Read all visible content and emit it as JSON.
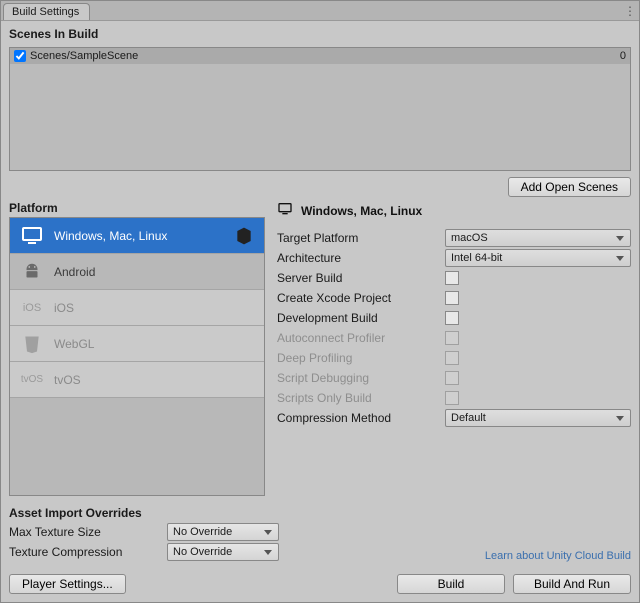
{
  "tab": {
    "title": "Build Settings"
  },
  "scenes": {
    "title": "Scenes In Build",
    "items": [
      {
        "checked": true,
        "path": "Scenes/SampleScene",
        "index": "0"
      }
    ],
    "addButton": "Add Open Scenes"
  },
  "platform": {
    "title": "Platform",
    "items": [
      {
        "label": "Windows, Mac, Linux",
        "selected": true,
        "dim": false
      },
      {
        "label": "Android",
        "selected": false,
        "dim": false
      },
      {
        "label": "iOS",
        "selected": false,
        "dim": true
      },
      {
        "label": "WebGL",
        "selected": false,
        "dim": true
      },
      {
        "label": "tvOS",
        "selected": false,
        "dim": true
      }
    ]
  },
  "right": {
    "title": "Windows, Mac, Linux",
    "targetPlatform": {
      "label": "Target Platform",
      "value": "macOS"
    },
    "architecture": {
      "label": "Architecture",
      "value": "Intel 64-bit"
    },
    "serverBuild": {
      "label": "Server Build"
    },
    "createXcode": {
      "label": "Create Xcode Project"
    },
    "devBuild": {
      "label": "Development Build"
    },
    "autoconnect": {
      "label": "Autoconnect Profiler"
    },
    "deepProfiling": {
      "label": "Deep Profiling"
    },
    "scriptDebug": {
      "label": "Script Debugging"
    },
    "scriptsOnly": {
      "label": "Scripts Only Build"
    },
    "compression": {
      "label": "Compression Method",
      "value": "Default"
    }
  },
  "asset": {
    "title": "Asset Import Overrides",
    "maxTexture": {
      "label": "Max Texture Size",
      "value": "No Override"
    },
    "texComp": {
      "label": "Texture Compression",
      "value": "No Override"
    }
  },
  "link": {
    "cloudBuild": "Learn about Unity Cloud Build"
  },
  "footer": {
    "playerSettings": "Player Settings...",
    "build": "Build",
    "buildAndRun": "Build And Run"
  },
  "iconText": {
    "ios": "iOS",
    "tvos": "tvOS"
  }
}
